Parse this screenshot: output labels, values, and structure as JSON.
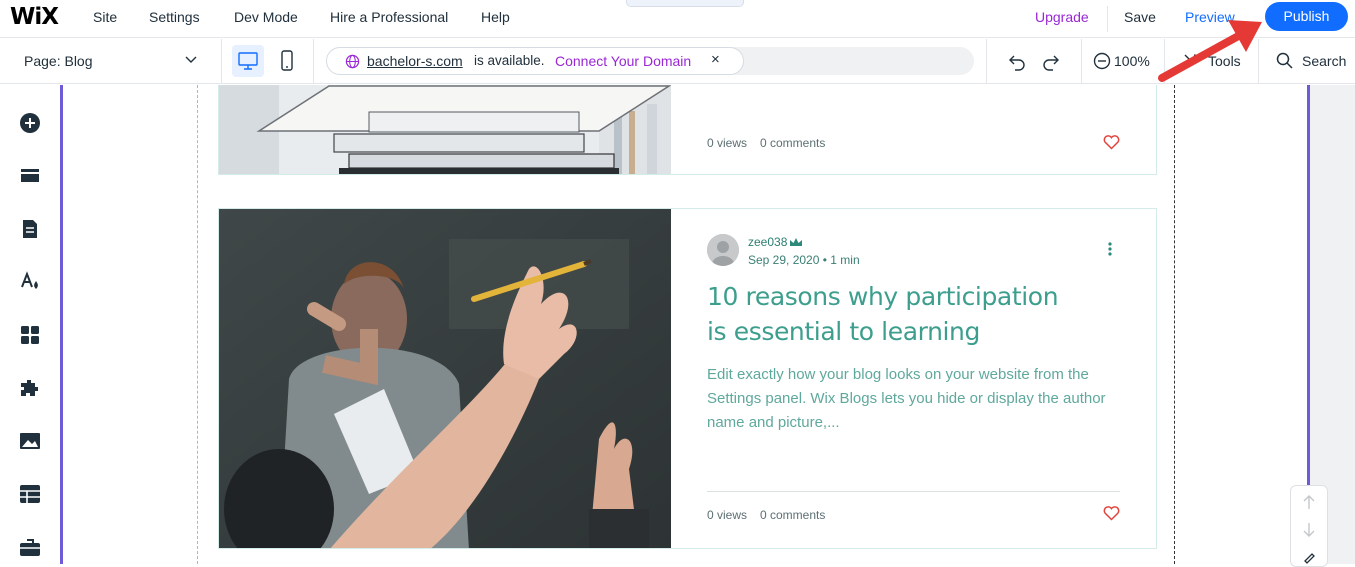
{
  "topbar": {
    "logo": "WiX",
    "menu": [
      "Site",
      "Settings",
      "Dev Mode",
      "Hire a Professional",
      "Help"
    ],
    "upgrade": "Upgrade",
    "save": "Save",
    "preview": "Preview",
    "publish": "Publish"
  },
  "toolbar": {
    "page_label": "Page: Blog",
    "domain": "bachelor-s.com",
    "availability": "is available.",
    "connect": "Connect Your Domain",
    "close": "×",
    "zoom": "100%",
    "tools": "Tools",
    "search": "Search"
  },
  "left_toolbar": {
    "items": [
      "add-icon",
      "sections-icon",
      "pages-icon",
      "design-icon",
      "apps-icon",
      "business-icon",
      "media-icon",
      "cms-icon",
      "portfolio-icon"
    ]
  },
  "posts": [
    {
      "views": "0 views",
      "comments": "0 comments"
    },
    {
      "author": "zee038",
      "date": "Sep 29, 2020",
      "read_time": "1 min",
      "title": "10 reasons why participation is essential to learning",
      "excerpt": "Edit exactly how your blog looks on your website from the Settings panel. Wix Blogs lets you hide or display the author name and picture,...",
      "views": "0 views",
      "comments": "0 comments"
    }
  ],
  "colors": {
    "accent": "#116dff",
    "upgrade": "#9a27d5",
    "canvas_border": "#6e5bd6",
    "post_title": "#3d9e8d",
    "heart": "#e0443c",
    "annotation_arrow": "#e53935"
  }
}
